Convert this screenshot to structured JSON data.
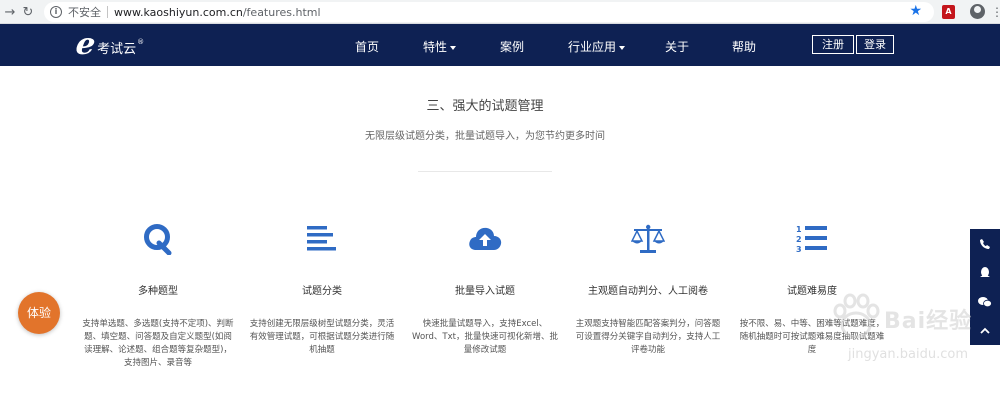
{
  "browser": {
    "insecure_label": "不安全",
    "url_host": "www.kaoshiyun.com.cn",
    "url_path": "/features.html",
    "pdf_ext_label": "A"
  },
  "header": {
    "logo_letter": "e",
    "logo_text": "考试云",
    "logo_reg": "®",
    "nav": [
      {
        "label": "首页"
      },
      {
        "label": "特性"
      },
      {
        "label": "案例"
      },
      {
        "label": "行业应用"
      },
      {
        "label": "关于"
      },
      {
        "label": "帮助"
      }
    ],
    "register_label": "注册",
    "login_label": "登录"
  },
  "section": {
    "title": "三、强大的试题管理",
    "subtitle": "无限层级试题分类，批量试题导入，为您节约更多时间"
  },
  "features": [
    {
      "icon": "q-letter-icon",
      "title": "多种题型",
      "desc": "支持单选题、多选题(支持不定项)、判断题、填空题、问答题及自定义题型(如阅读理解、论述题、组合题等复杂题型)，支持图片、录音等"
    },
    {
      "icon": "align-left-icon",
      "title": "试题分类",
      "desc": "支持创建无限层级树型试题分类，灵活有效管理试题，可根据试题分类进行随机抽题"
    },
    {
      "icon": "cloud-upload-icon",
      "title": "批量导入试题",
      "desc": "快速批量试题导入，支持Excel、Word、Txt，批量快速可视化新增、批量修改试题"
    },
    {
      "icon": "balance-scale-icon",
      "title": "主观题自动判分、人工阅卷",
      "desc": "主观题支持智能匹配答案判分，问答题可设置得分关键字自动判分，支持人工评卷功能"
    },
    {
      "icon": "ordered-list-icon",
      "title": "试题难易度",
      "desc": "按不限、易、中等、困难等试题难度，随机抽题时可按试题难易度抽取试题难度"
    }
  ],
  "trial_label": "体验",
  "watermark": {
    "text": "Bai经验",
    "url": "jingyan.baidu.com"
  },
  "colors": {
    "header_bg": "#0e2153",
    "icon_blue": "#2f6bc4",
    "trial_orange": "#e2742b"
  }
}
